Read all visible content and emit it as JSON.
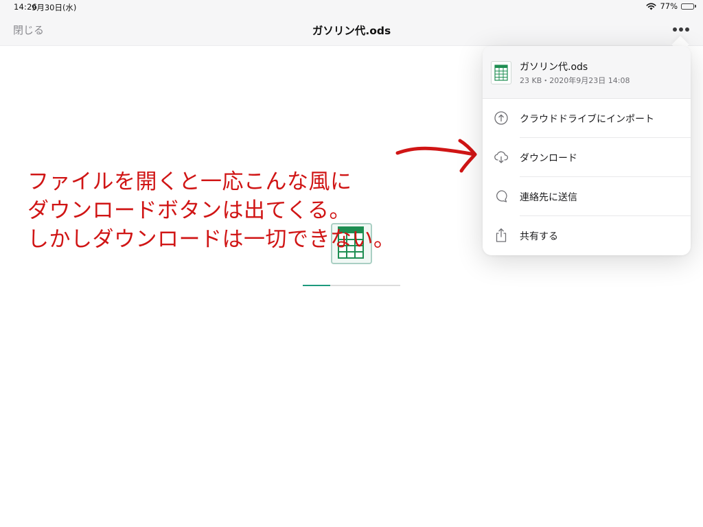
{
  "status_bar": {
    "time": "14:26",
    "date": "9月30日(水)",
    "battery": "77%",
    "battery_level": 0.77
  },
  "nav": {
    "close_label": "閉じる",
    "title": "ガソリン代.ods"
  },
  "loading": {
    "progress": 0.28
  },
  "popover": {
    "file_name": "ガソリン代.ods",
    "file_meta": "23 KB・2020年9月23日 14:08",
    "items": [
      {
        "label": "クラウドドライブにインポート",
        "icon": "cloud-upload-icon"
      },
      {
        "label": "ダウンロード",
        "icon": "cloud-download-icon"
      },
      {
        "label": "連絡先に送信",
        "icon": "chat-bubble-icon"
      },
      {
        "label": "共有する",
        "icon": "share-icon"
      }
    ]
  },
  "annotation": {
    "lines": [
      "ファイルを開くと一応こんな風に",
      "ダウンロードボタンは出てくる。",
      "しかしダウンロードは一切できない。"
    ]
  },
  "colors": {
    "accent_green": "#1d9a7c",
    "annotation_red": "#d01515",
    "spreadsheet_green": "#1e8e52"
  }
}
